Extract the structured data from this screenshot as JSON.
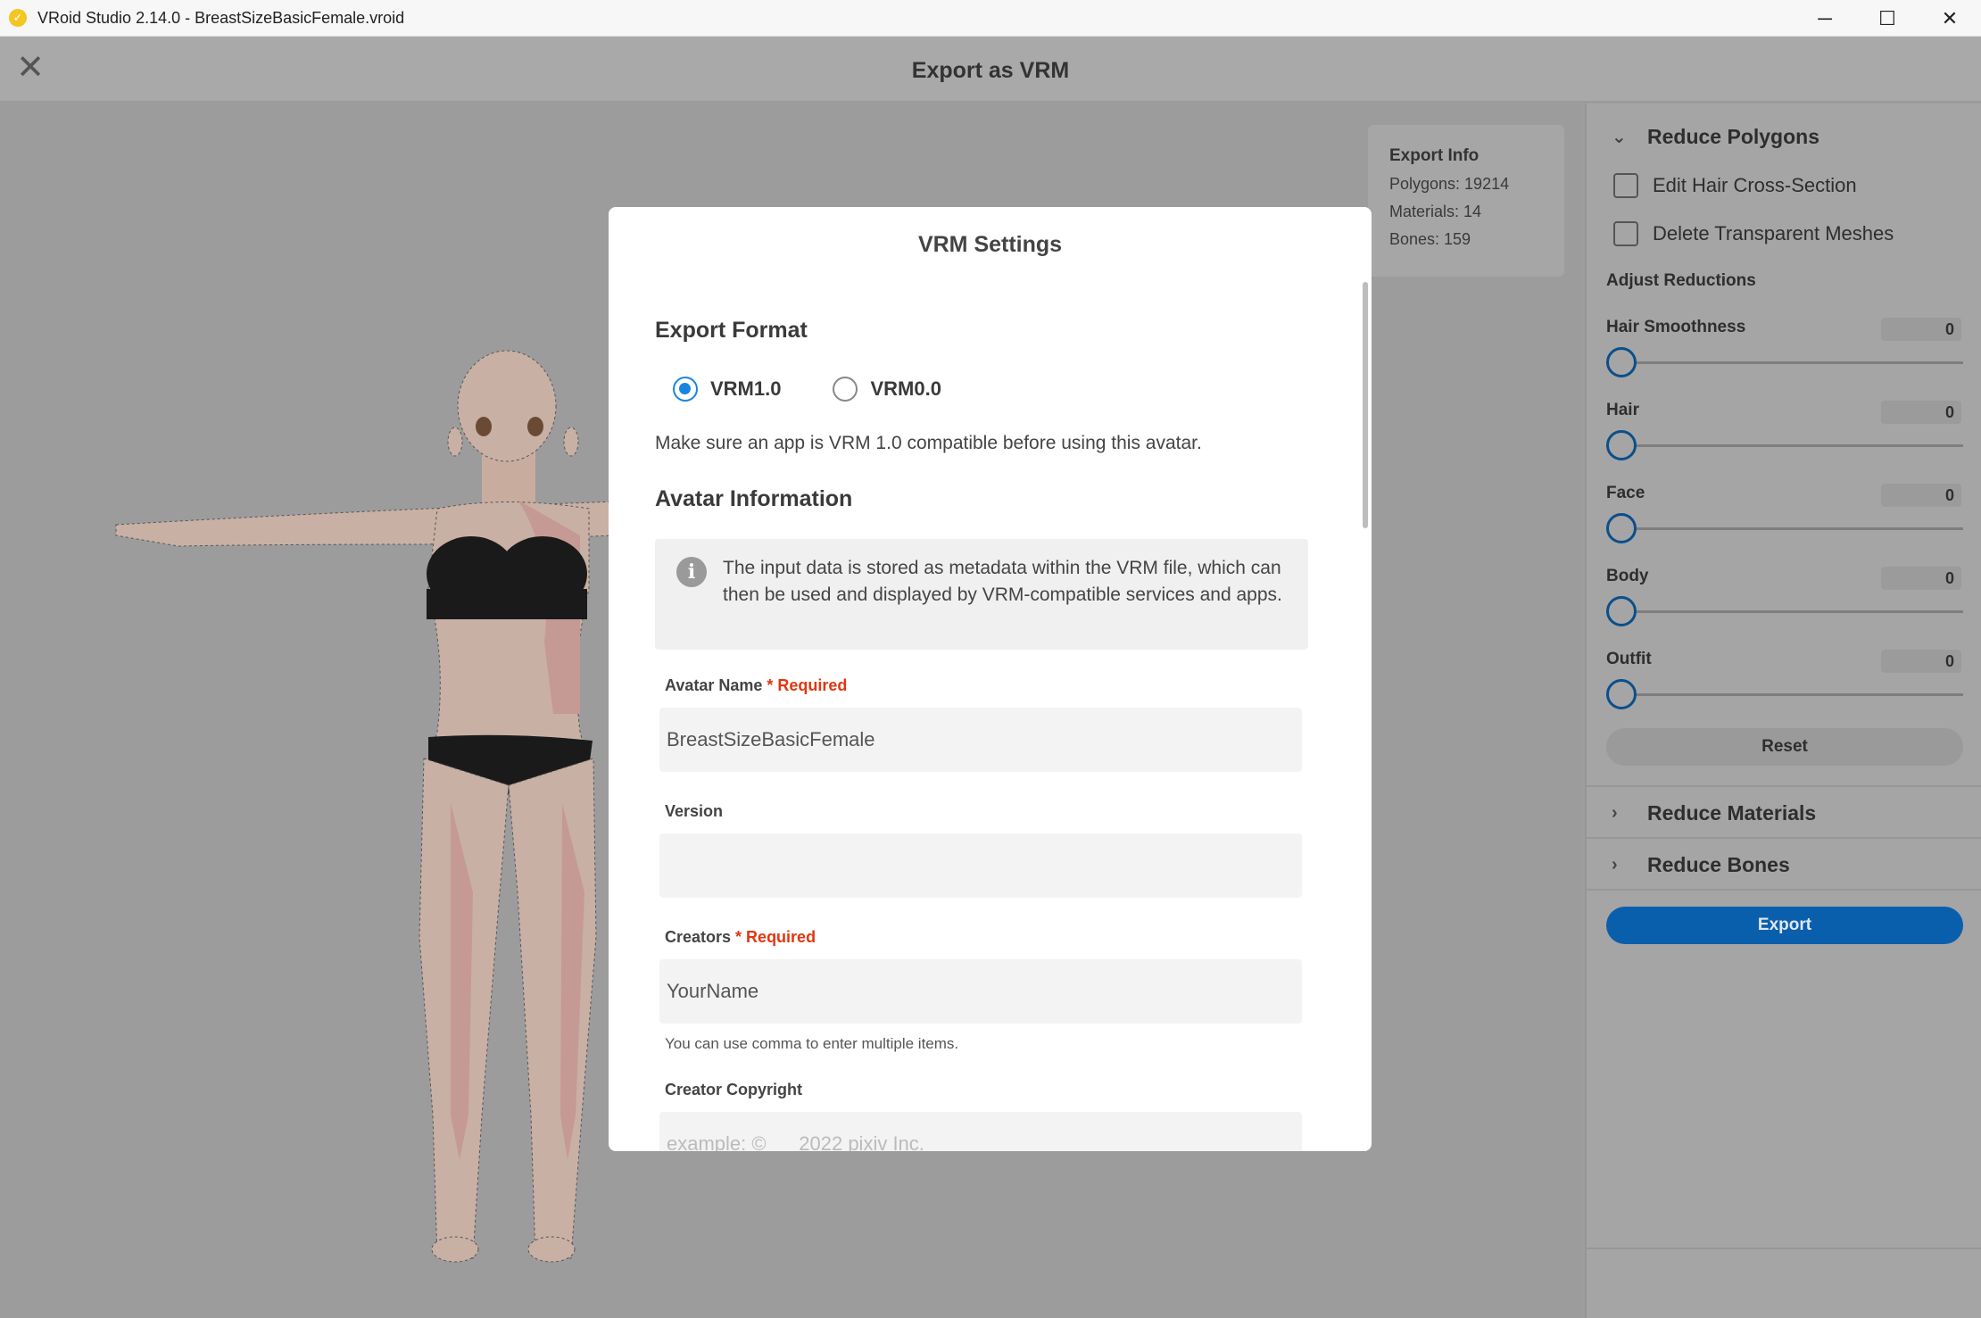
{
  "window": {
    "title": "VRoid Studio 2.14.0 - BreastSizeBasicFemale.vroid",
    "app_icon": "vroid-logo-icon",
    "controls": [
      "─",
      "☐",
      "✕"
    ]
  },
  "header": {
    "title": "Export as VRM",
    "close_icon": "✕"
  },
  "export_info": {
    "title": "Export Info",
    "polygons": "Polygons: 19214",
    "materials": "Materials: 14",
    "bones": "Bones: 159"
  },
  "panel": {
    "reduce_polygons": "Reduce Polygons",
    "edit_hair_cross_section": "Edit Hair Cross-Section",
    "delete_transparent_meshes": "Delete Transparent Meshes",
    "adjust_reductions": "Adjust Reductions",
    "sliders": [
      {
        "label": "Hair Smoothness",
        "value": "0"
      },
      {
        "label": "Hair",
        "value": "0"
      },
      {
        "label": "Face",
        "value": "0"
      },
      {
        "label": "Body",
        "value": "0"
      },
      {
        "label": "Outfit",
        "value": "0"
      }
    ],
    "reset": "Reset",
    "reduce_materials": "Reduce Materials",
    "reduce_bones": "Reduce Bones",
    "export": "Export",
    "accent_color": "#0a5fad"
  },
  "modal": {
    "title": "VRM Settings",
    "export_format": "Export Format",
    "vrm10": "VRM1.0",
    "vrm00": "VRM0.0",
    "selected_format": "VRM1.0",
    "compat_note": "Make sure an app is VRM 1.0 compatible before using this avatar.",
    "avatar_information": "Avatar Information",
    "info_text": "The input data is stored as metadata within the VRM file, which can then be used and displayed by VRM-compatible services and apps.",
    "required_mark": "* Required",
    "avatar_name_label": "Avatar Name",
    "avatar_name_value": "BreastSizeBasicFemale",
    "version_label": "Version",
    "version_value": "",
    "creators_label": "Creators",
    "creators_value": "YourName",
    "creators_help": "You can use comma to enter multiple items.",
    "copyright_label": "Creator Copyright",
    "copyright_placeholder": "example: ©      2022 pixiv Inc.",
    "radio_color": "#1a84e0",
    "required_color": "#e2360f"
  }
}
